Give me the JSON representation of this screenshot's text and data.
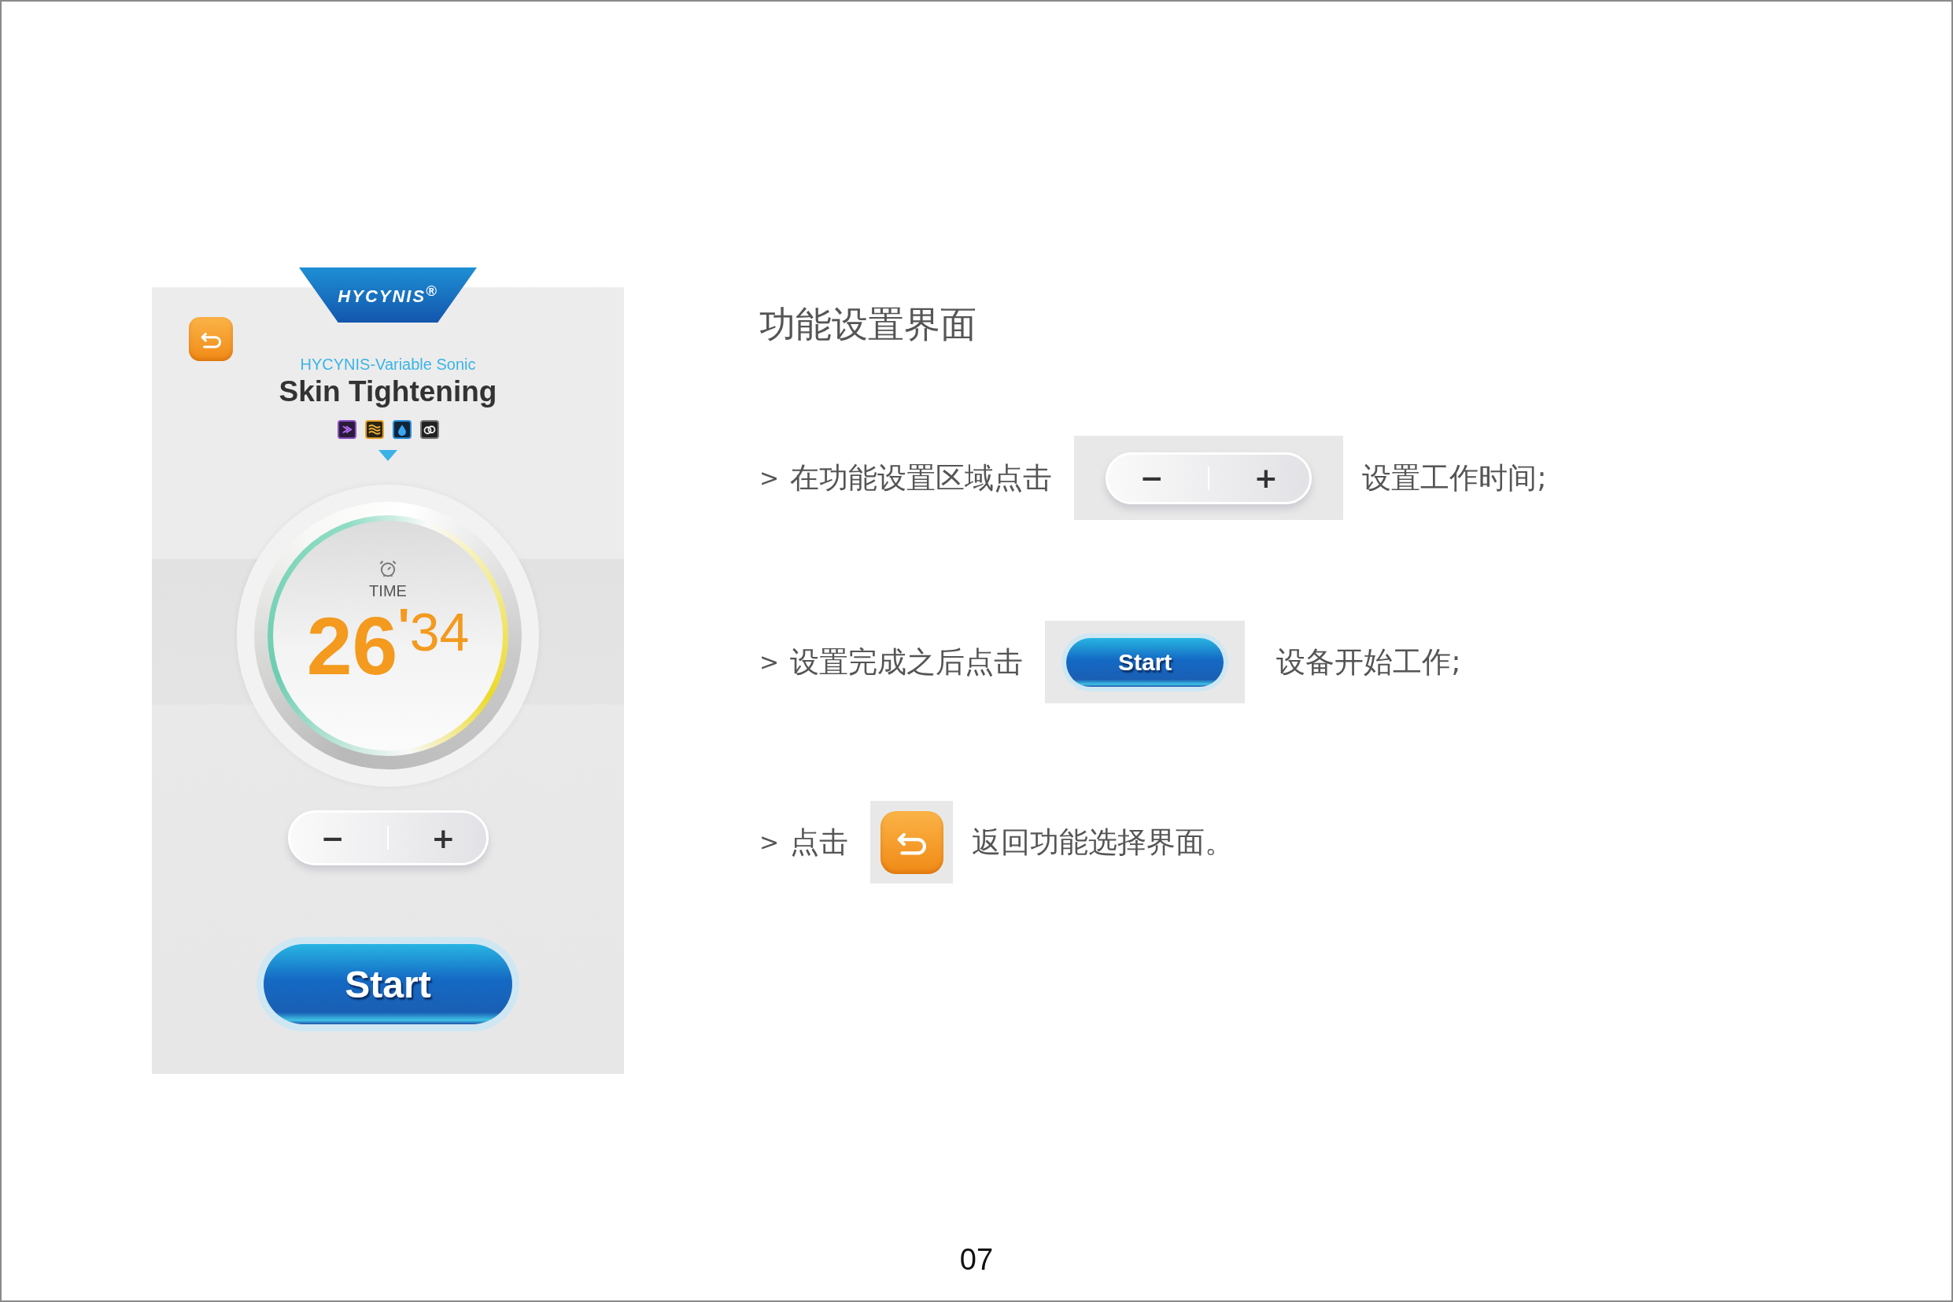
{
  "device_screen": {
    "logo": "HYCYNIS$^{®}$",
    "subtitle": "HYCYNIS-Variable Sonic",
    "title": "Skin Tightening",
    "timer": {
      "label": "TIME",
      "minutes": "26",
      "separator": "'",
      "seconds": "34"
    },
    "stepper": {
      "minus": "−",
      "plus": "+"
    },
    "start_button": "Start"
  },
  "instructions": {
    "title": "功能设置界面",
    "steps": [
      {
        "kind": "stepper",
        "marker": ">",
        "before": "在功能设置区域点击",
        "minus": "−",
        "plus": "+",
        "after": "设置工作时间;"
      },
      {
        "kind": "start",
        "marker": ">",
        "before": "设置完成之后点击",
        "label": "Start",
        "after": "设备开始工作;"
      },
      {
        "kind": "back",
        "marker": ">",
        "before": "点击",
        "after": "返回功能选择界面。"
      }
    ]
  },
  "page_number": "07"
}
